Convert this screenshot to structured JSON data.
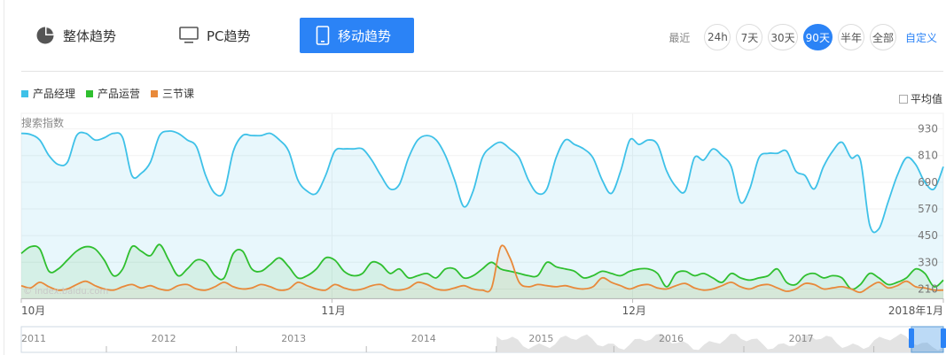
{
  "tabs": [
    {
      "label": "整体趋势",
      "icon": "pie-chart-icon"
    },
    {
      "label": "PC趋势",
      "icon": "monitor-icon"
    },
    {
      "label": "移动趋势",
      "icon": "mobile-icon"
    }
  ],
  "active_tab": 2,
  "period": {
    "label": "最近",
    "options": [
      "24h",
      "7天",
      "30天",
      "90天",
      "半年",
      "全部"
    ],
    "active": "90天",
    "custom": "自定义"
  },
  "avg_label": "平均值",
  "watermark": "© index.baidu.com",
  "colors": {
    "accent": "#2b83f6",
    "series": [
      "#3ec1e8",
      "#2fbf2f",
      "#e8893a"
    ]
  },
  "chart_data": {
    "type": "line",
    "ylabel": "搜索指数",
    "yticks": [
      930,
      810,
      690,
      570,
      450,
      330,
      210
    ],
    "ylim": [
      168,
      1000
    ],
    "x_tick_labels": [
      "10月",
      "11月",
      "12月",
      "2018年1月"
    ],
    "x_tick_positions": [
      0,
      31,
      61,
      92
    ],
    "num_days": 93,
    "series": [
      {
        "name": "产品经理",
        "values": [
          910,
          905,
          880,
          810,
          770,
          780,
          900,
          910,
          880,
          890,
          910,
          890,
          720,
          730,
          780,
          900,
          920,
          910,
          880,
          850,
          720,
          640,
          650,
          830,
          900,
          900,
          900,
          910,
          880,
          830,
          700,
          650,
          640,
          720,
          830,
          840,
          840,
          840,
          790,
          720,
          660,
          680,
          800,
          880,
          900,
          880,
          810,
          700,
          580,
          650,
          800,
          850,
          870,
          840,
          800,
          700,
          640,
          660,
          800,
          880,
          860,
          840,
          800,
          700,
          640,
          740,
          880,
          860,
          880,
          860,
          740,
          670,
          650,
          800,
          790,
          840,
          810,
          760,
          600,
          660,
          800,
          820,
          820,
          830,
          740,
          720,
          660,
          760,
          830,
          870,
          800,
          790,
          500,
          480,
          600,
          720,
          800,
          770,
          690,
          660,
          760
        ]
      },
      {
        "name": "产品运营",
        "values": [
          370,
          400,
          390,
          290,
          300,
          340,
          380,
          400,
          390,
          340,
          270,
          300,
          400,
          380,
          360,
          410,
          340,
          270,
          300,
          340,
          330,
          270,
          260,
          370,
          380,
          300,
          290,
          320,
          350,
          310,
          260,
          270,
          300,
          350,
          340,
          290,
          270,
          280,
          330,
          320,
          280,
          300,
          260,
          270,
          280,
          260,
          300,
          300,
          260,
          270,
          300,
          330,
          300,
          290,
          280,
          270,
          270,
          330,
          310,
          300,
          290,
          260,
          270,
          290,
          280,
          270,
          290,
          300,
          300,
          280,
          220,
          280,
          290,
          270,
          280,
          260,
          240,
          280,
          260,
          250,
          260,
          270,
          300,
          240,
          230,
          270,
          280,
          260,
          270,
          260,
          210,
          230,
          280,
          260,
          230,
          240,
          260,
          300,
          280,
          220,
          250
        ]
      },
      {
        "name": "三节课",
        "values": [
          225,
          215,
          240,
          220,
          205,
          210,
          230,
          245,
          225,
          210,
          205,
          220,
          230,
          215,
          225,
          210,
          205,
          225,
          230,
          210,
          205,
          220,
          240,
          220,
          210,
          215,
          230,
          220,
          205,
          210,
          240,
          225,
          210,
          205,
          230,
          215,
          205,
          210,
          225,
          230,
          210,
          205,
          215,
          240,
          230,
          210,
          205,
          215,
          225,
          210,
          205,
          215,
          400,
          350,
          240,
          220,
          230,
          225,
          220,
          225,
          215,
          210,
          220,
          260,
          240,
          225,
          210,
          225,
          230,
          215,
          210,
          225,
          235,
          215,
          205,
          210,
          225,
          240,
          220,
          210,
          225,
          230,
          215,
          200,
          210,
          235,
          230,
          210,
          215,
          220,
          210,
          195,
          220,
          240,
          215,
          225,
          245,
          220,
          215,
          205,
          205
        ]
      }
    ],
    "navigator": {
      "year_labels": [
        "2011",
        "2012",
        "2013",
        "2014",
        "2015",
        "2016",
        "2017"
      ]
    }
  }
}
